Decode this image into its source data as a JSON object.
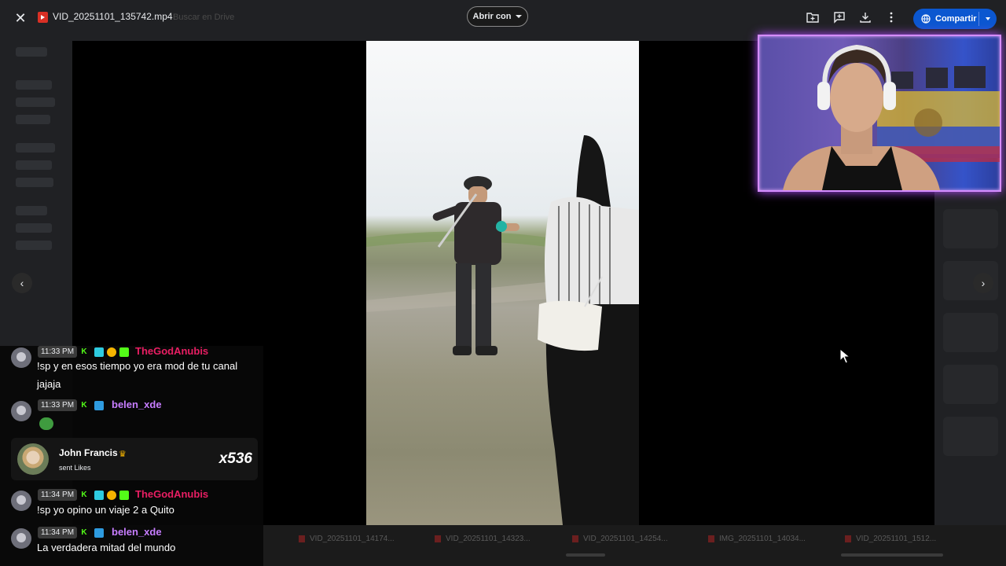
{
  "topbar": {
    "file_name": "VID_20251101_135742.mp4",
    "drive_link": "Buscar en Drive",
    "open_with": "Abrir con",
    "share": "Compartir"
  },
  "icons": {
    "close": "close-icon",
    "add_to_folder": "folder-add-icon",
    "comment": "add-comment-icon",
    "download": "download-icon",
    "more": "more-vert-icon"
  },
  "chat": {
    "messages": [
      {
        "time": "11:33 PM",
        "user": "TheGodAnubis",
        "user_color": "#e91e63",
        "text_line1": "!sp y en esos tiempo yo era mod de tu canal",
        "text_line2": "jajaja"
      },
      {
        "time": "11:33 PM",
        "user": "belen_xde",
        "user_color": "#c77dff",
        "text": ""
      },
      {
        "time": "11:34 PM",
        "user": "TheGodAnubis",
        "user_color": "#e91e63",
        "text": "!sp yo opino un viaje 2 a Quito"
      },
      {
        "time": "11:34 PM",
        "user": "belen_xde",
        "user_color": "#c77dff",
        "text": "La verdadera mitad del mundo"
      }
    ],
    "like_event": {
      "name": "John Francis",
      "sub": "sent Likes",
      "count": "x536"
    }
  },
  "filmstrip": [
    "VID_20251101_14174...",
    "VID_20251101_14323...",
    "VID_20251101_14254...",
    "IMG_20251101_14034...",
    "VID_20251101_1512..."
  ],
  "colors": {
    "accent_share": "#0b57d0",
    "webcam_glow": "#b04cff",
    "kick_green": "#53fc18"
  }
}
